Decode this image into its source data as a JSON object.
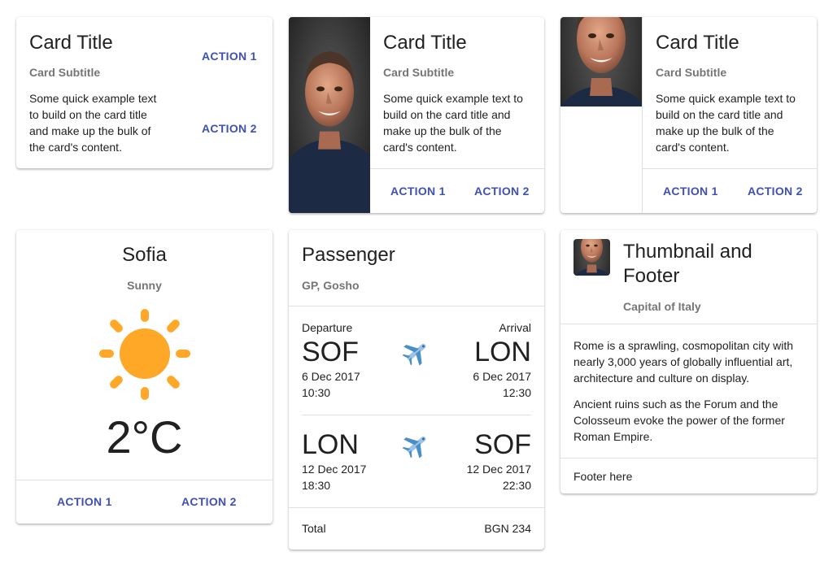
{
  "card1": {
    "title": "Card Title",
    "subtitle": "Card Subtitle",
    "text": "Some quick example text to build on the card title and make up the bulk of the card's content.",
    "action1": "ACTION 1",
    "action2": "ACTION 2"
  },
  "card2": {
    "title": "Card Title",
    "subtitle": "Card Subtitle",
    "text": "Some quick example text to build on the card title and make up the bulk of the card's content.",
    "action1": "ACTION 1",
    "action2": "ACTION 2"
  },
  "card3": {
    "title": "Card Title",
    "subtitle": "Card Subtitle",
    "text": "Some quick example text to build on the card title and make up the bulk of the card's content.",
    "action1": "ACTION 1",
    "action2": "ACTION 2"
  },
  "weather": {
    "city": "Sofia",
    "condition": "Sunny",
    "temperature": "2°C",
    "icon": "sun-icon",
    "action1": "ACTION 1",
    "action2": "ACTION 2"
  },
  "passenger": {
    "title": "Passenger",
    "subtitle": "GP, Gosho",
    "departure_label": "Departure",
    "arrival_label": "Arrival",
    "flights": [
      {
        "from": "SOF",
        "to": "LON",
        "dep_date": "6 Dec 2017",
        "dep_time": "10:30",
        "arr_date": "6 Dec 2017",
        "arr_time": "12:30",
        "icon": "airplane-icon"
      },
      {
        "from": "LON",
        "to": "SOF",
        "dep_date": "12 Dec 2017",
        "dep_time": "18:30",
        "arr_date": "12 Dec 2017",
        "arr_time": "22:30",
        "icon": "airplane-icon"
      }
    ],
    "total_label": "Total",
    "total_value": "BGN 234"
  },
  "thumbnail": {
    "title": "Thumbnail and Footer",
    "subtitle": "Capital of Italy",
    "paragraph1": "Rome is a sprawling, cosmopolitan city with nearly 3,000 years of globally influential art, architecture and culture on display.",
    "paragraph2": "Ancient ruins such as the Forum and the Colosseum evoke the power of the former Roman Empire.",
    "footer": "Footer here"
  },
  "colors": {
    "accent": "#3f51b5",
    "sun": "#ffa726",
    "divider": "#e0e0e0",
    "subtitle": "#757575"
  }
}
